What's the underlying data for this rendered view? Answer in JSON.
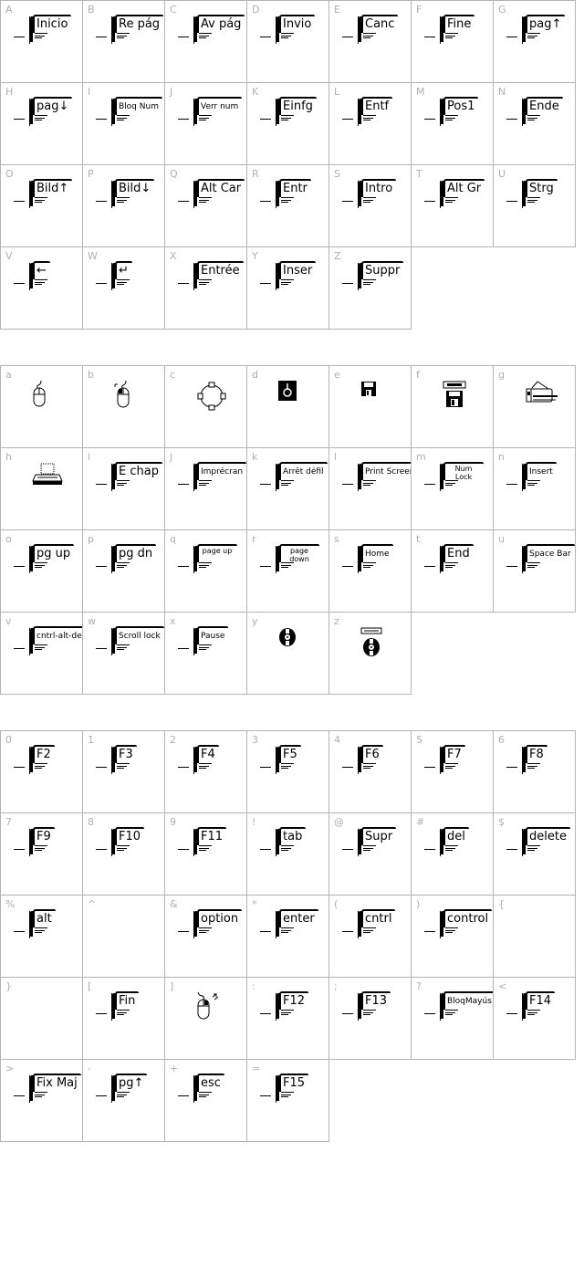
{
  "sections": [
    {
      "cells": [
        {
          "char": "A",
          "key": "Inicio"
        },
        {
          "char": "B",
          "key": "Re pág"
        },
        {
          "char": "C",
          "key": "Av pág"
        },
        {
          "char": "D",
          "key": "Invio"
        },
        {
          "char": "E",
          "key": "Canc"
        },
        {
          "char": "F",
          "key": "Fine"
        },
        {
          "char": "G",
          "key": "pag↑"
        },
        {
          "char": "H",
          "key": "pag↓"
        },
        {
          "char": "I",
          "key": "Bloq Num",
          "size": "small"
        },
        {
          "char": "J",
          "key": "Verr num",
          "size": "small"
        },
        {
          "char": "K",
          "key": "Einfg"
        },
        {
          "char": "L",
          "key": "Entf"
        },
        {
          "char": "M",
          "key": "Pos1"
        },
        {
          "char": "N",
          "key": "Ende"
        },
        {
          "char": "O",
          "key": "Bild↑"
        },
        {
          "char": "P",
          "key": "Bild↓"
        },
        {
          "char": "Q",
          "key": "Alt Car"
        },
        {
          "char": "R",
          "key": "Entr"
        },
        {
          "char": "S",
          "key": "Intro"
        },
        {
          "char": "T",
          "key": "Alt Gr"
        },
        {
          "char": "U",
          "key": "Strg"
        },
        {
          "char": "V",
          "key": "←",
          "icon": "backspace-arrow-icon"
        },
        {
          "char": "W",
          "key": "↵",
          "icon": "return-key-icon"
        },
        {
          "char": "X",
          "key": "Entrée"
        },
        {
          "char": "Y",
          "key": "Inser"
        },
        {
          "char": "Z",
          "key": "Suppr"
        }
      ]
    },
    {
      "cells": [
        {
          "char": "a",
          "icon": "mouse-icon"
        },
        {
          "char": "b",
          "icon": "mouse-left-click-icon"
        },
        {
          "char": "c",
          "icon": "circle-selection-handles-icon"
        },
        {
          "char": "d",
          "icon": "power-button-icon"
        },
        {
          "char": "e",
          "icon": "floppy-disk-icon"
        },
        {
          "char": "f",
          "icon": "floppy-drive-icon"
        },
        {
          "char": "g",
          "icon": "laser-printer-icon"
        },
        {
          "char": "h",
          "icon": "dot-matrix-printer-icon"
        },
        {
          "char": "i",
          "key": "E chap"
        },
        {
          "char": "j",
          "key": "Imprécran",
          "size": "small"
        },
        {
          "char": "k",
          "key": "Arrêt défil",
          "size": "small"
        },
        {
          "char": "l",
          "key": "Print Screen",
          "size": "small"
        },
        {
          "char": "m",
          "key": "Num Lock",
          "size": "tiny"
        },
        {
          "char": "n",
          "key": "Insert",
          "size": "small"
        },
        {
          "char": "o",
          "key": "pg up"
        },
        {
          "char": "p",
          "key": "pg dn"
        },
        {
          "char": "q",
          "key": "page up",
          "size": "tiny"
        },
        {
          "char": "r",
          "key": "page down",
          "size": "tiny"
        },
        {
          "char": "s",
          "key": "Home",
          "size": "small"
        },
        {
          "char": "t",
          "key": "End"
        },
        {
          "char": "u",
          "key": "Space Bar",
          "size": "small"
        },
        {
          "char": "v",
          "key": "cntrl-alt-del",
          "size": "small"
        },
        {
          "char": "w",
          "key": "Scroll lock",
          "size": "small"
        },
        {
          "char": "x",
          "key": "Pause",
          "size": "small"
        },
        {
          "char": "y",
          "icon": "cd-disc-icon"
        },
        {
          "char": "z",
          "icon": "cd-drive-icon"
        }
      ]
    },
    {
      "cells": [
        {
          "char": "0",
          "key": "F2"
        },
        {
          "char": "1",
          "key": "F3"
        },
        {
          "char": "2",
          "key": "F4"
        },
        {
          "char": "3",
          "key": "F5"
        },
        {
          "char": "4",
          "key": "F6"
        },
        {
          "char": "5",
          "key": "F7"
        },
        {
          "char": "6",
          "key": "F8"
        },
        {
          "char": "7",
          "key": "F9"
        },
        {
          "char": "8",
          "key": "F10"
        },
        {
          "char": "9",
          "key": "F11"
        },
        {
          "char": "!",
          "key": "tab"
        },
        {
          "char": "@",
          "key": "Supr"
        },
        {
          "char": "#",
          "key": "del"
        },
        {
          "char": "$",
          "key": "delete"
        },
        {
          "char": "%",
          "key": "alt"
        },
        {
          "char": "^"
        },
        {
          "char": "&",
          "key": "option"
        },
        {
          "char": "*",
          "key": "enter"
        },
        {
          "char": "(",
          "key": "cntrl"
        },
        {
          "char": ")",
          "key": "control"
        },
        {
          "char": "{"
        },
        {
          "char": "}"
        },
        {
          "char": "[",
          "key": "Fin"
        },
        {
          "char": "]",
          "icon": "mouse-right-click-icon"
        },
        {
          "char": ":",
          "key": "F12"
        },
        {
          "char": ";",
          "key": "F13"
        },
        {
          "char": "?",
          "key": "BloqMayús",
          "size": "small"
        },
        {
          "char": "<",
          "key": "F14"
        },
        {
          "char": ">",
          "key": "Fix Maj"
        },
        {
          "char": "-",
          "key": "pg↑"
        },
        {
          "char": "+",
          "key": "esc"
        },
        {
          "char": "=",
          "key": "F15"
        }
      ]
    }
  ]
}
